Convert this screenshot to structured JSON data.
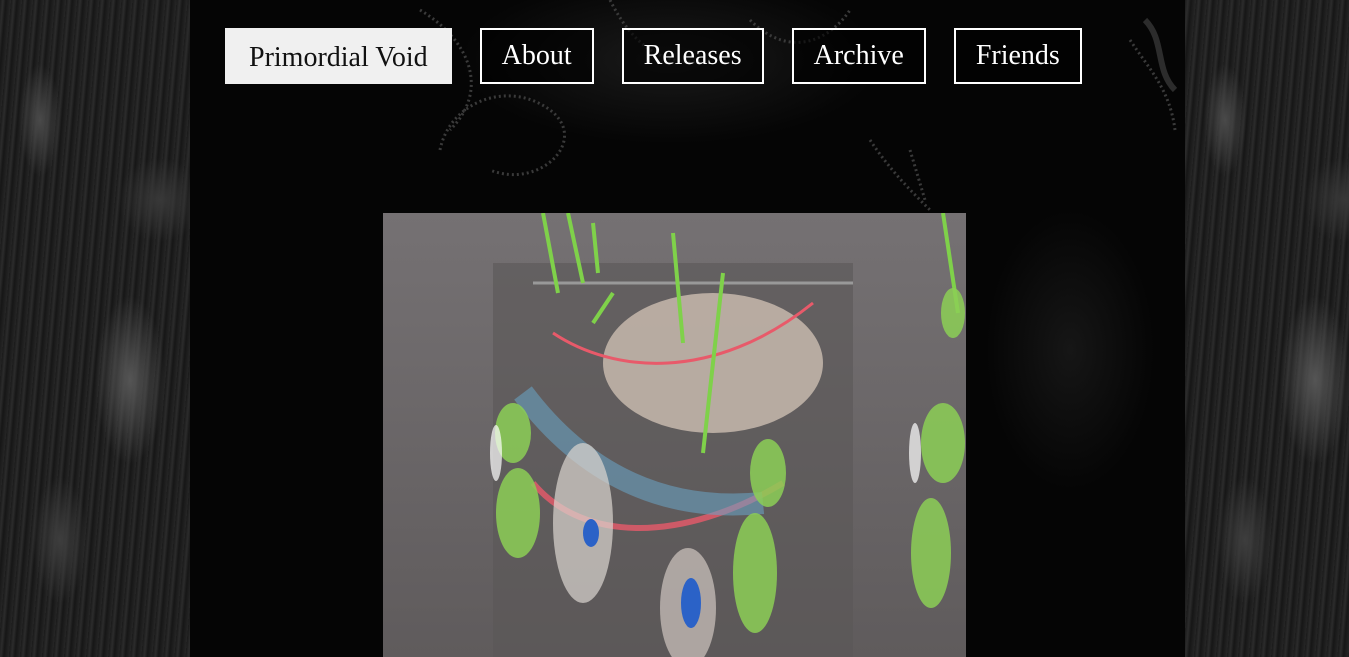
{
  "nav": {
    "home_label": "Primordial Void",
    "items": [
      {
        "label": "About"
      },
      {
        "label": "Releases"
      },
      {
        "label": "Archive"
      },
      {
        "label": "Friends"
      }
    ]
  },
  "media": {
    "kind": "looping-video-artwork",
    "palette": [
      "#6e6a6b",
      "#7fd14a",
      "#e85a6a",
      "#3a9ad9",
      "#d8c9b8"
    ]
  },
  "colors": {
    "background": "#000000",
    "nav_border": "#ffffff",
    "nav_home_bg": "#f0f0f0",
    "nav_home_text": "#111111"
  }
}
